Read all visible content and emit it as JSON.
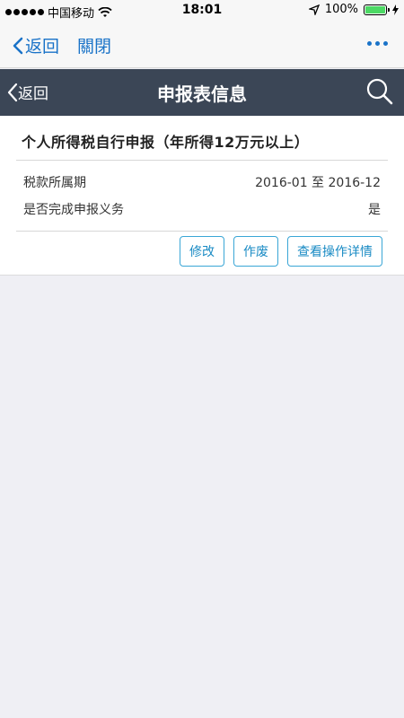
{
  "status_bar": {
    "carrier": "中国移动",
    "time": "18:01",
    "battery": "100%"
  },
  "wx_nav": {
    "back_label": "返回",
    "close_label": "關閉"
  },
  "app_header": {
    "back_label": "返回",
    "title": "申报表信息"
  },
  "card": {
    "title": "个人所得税自行申报（年所得12万元以上）",
    "rows": [
      {
        "label": "税款所属期",
        "value": "2016-01 至 2016-12"
      },
      {
        "label": "是否完成申报义务",
        "value": "是"
      }
    ],
    "buttons": {
      "modify": "修改",
      "void": "作废",
      "details": "查看操作详情"
    }
  },
  "colors": {
    "header_bg": "#3b4656",
    "link": "#1a73c8",
    "button_border": "#3aa6d6",
    "background": "#efeff4"
  }
}
